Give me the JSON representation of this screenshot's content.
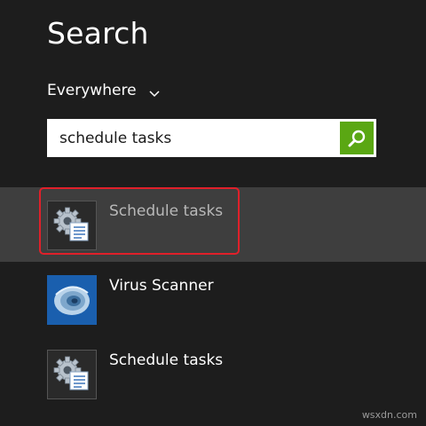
{
  "header": {
    "title": "Search"
  },
  "scope": {
    "label": "Everywhere"
  },
  "search": {
    "value": "schedule tasks"
  },
  "results": [
    {
      "label": "Schedule tasks",
      "icon": "task-scheduler-icon",
      "selected": true
    },
    {
      "label": "Virus Scanner",
      "icon": "virus-scanner-icon",
      "selected": false
    },
    {
      "label": "Schedule tasks",
      "icon": "task-scheduler-icon",
      "selected": false
    }
  ],
  "colors": {
    "background": "#1d1d1d",
    "search_button": "#5aa713",
    "selected_row": "#3e3e3e",
    "annotation_box": "#e0202a",
    "virus_tile": "#1a5fae"
  },
  "watermark": "wsxdn.com"
}
